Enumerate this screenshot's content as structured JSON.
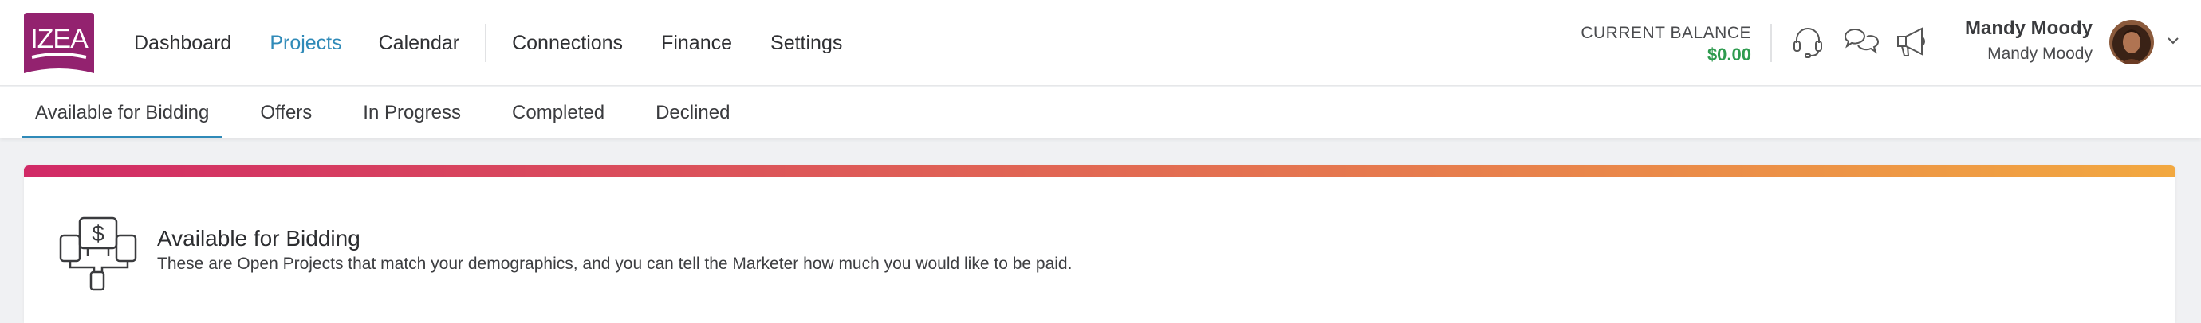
{
  "brand": {
    "logo_text": "IZEA",
    "logo_color": "#93226f"
  },
  "nav": {
    "items": [
      {
        "label": "Dashboard",
        "active": false
      },
      {
        "label": "Projects",
        "active": true
      },
      {
        "label": "Calendar",
        "active": false
      },
      {
        "label": "Connections",
        "active": false
      },
      {
        "label": "Finance",
        "active": false
      },
      {
        "label": "Settings",
        "active": false
      }
    ]
  },
  "balance": {
    "label": "CURRENT BALANCE",
    "value": "$0.00"
  },
  "header_icons": [
    "headset-icon",
    "chat-icon",
    "megaphone-icon"
  ],
  "user": {
    "name": "Mandy Moody",
    "subtitle": "Mandy Moody"
  },
  "subnav": {
    "tabs": [
      {
        "label": "Available for Bidding",
        "active": true
      },
      {
        "label": "Offers",
        "active": false
      },
      {
        "label": "In Progress",
        "active": false
      },
      {
        "label": "Completed",
        "active": false
      },
      {
        "label": "Declined",
        "active": false
      }
    ]
  },
  "card": {
    "icon": "bidding-dollar-icon",
    "title": "Available for Bidding",
    "description": "These are Open Projects that match your demographics, and you can tell the Marketer how much you would like to be paid."
  },
  "colors": {
    "accent": "#2f8ab8",
    "balance_green": "#2e9b4f",
    "stripe_start": "#d12a66",
    "stripe_end": "#f2a840"
  }
}
